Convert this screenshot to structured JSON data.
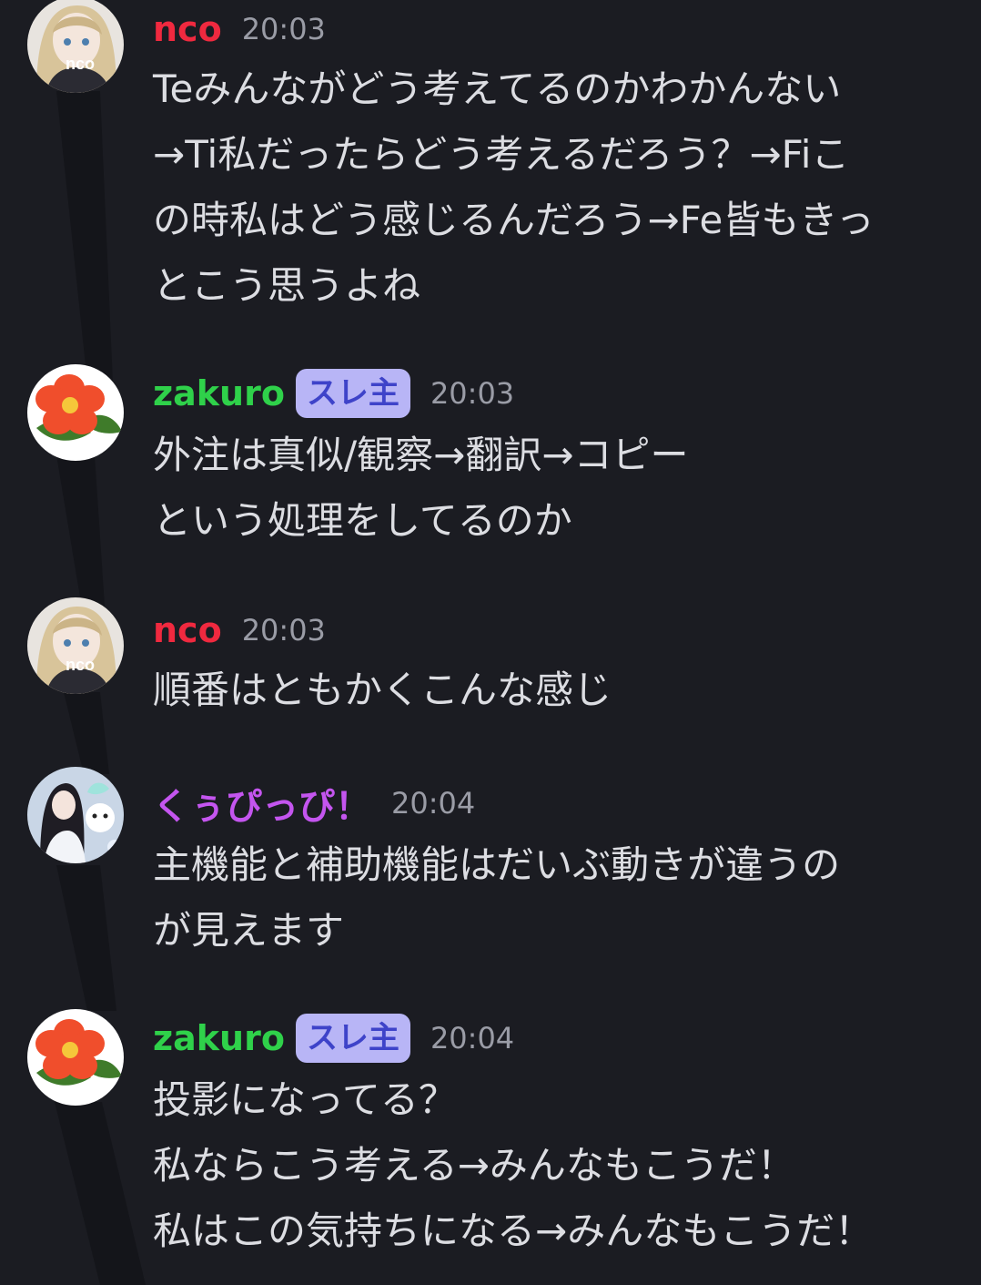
{
  "colors": {
    "background": "#1b1c22",
    "name_nco": "#f0293f",
    "name_zakuro": "#2fd14a",
    "name_kuppi": "#c455ef",
    "badge_bg": "#b8b5f6",
    "badge_text": "#3e43c9",
    "timestamp": "#9a9ca6",
    "message_text": "#dcdde2"
  },
  "messages": [
    {
      "author": "nco",
      "avatar_label": "nco",
      "time": "20:03",
      "lines": [
        "Teみんながどう考えてるのかわかんない",
        "→Ti私だったらどう考えるだろう？→Fiこ",
        "の時私はどう感じるんだろう→Fe皆もきっ",
        "とこう思うよね"
      ]
    },
    {
      "author": "zakuro",
      "badge": "スレ主",
      "time": "20:03",
      "lines": [
        "外注は真似/観察→翻訳→コピー",
        "という処理をしてるのか"
      ]
    },
    {
      "author": "nco",
      "avatar_label": "nco",
      "time": "20:03",
      "lines": [
        "順番はともかくこんな感じ"
      ]
    },
    {
      "author": "くぅぴっぴ！",
      "time": "20:04",
      "lines": [
        "主機能と補助機能はだいぶ動きが違うの",
        "が見えます"
      ]
    },
    {
      "author": "zakuro",
      "badge": "スレ主",
      "time": "20:04",
      "lines": [
        "投影になってる？",
        "私ならこう考える→みんなもこうだ！",
        "私はこの気持ちになる→みんなもこうだ！"
      ]
    }
  ]
}
